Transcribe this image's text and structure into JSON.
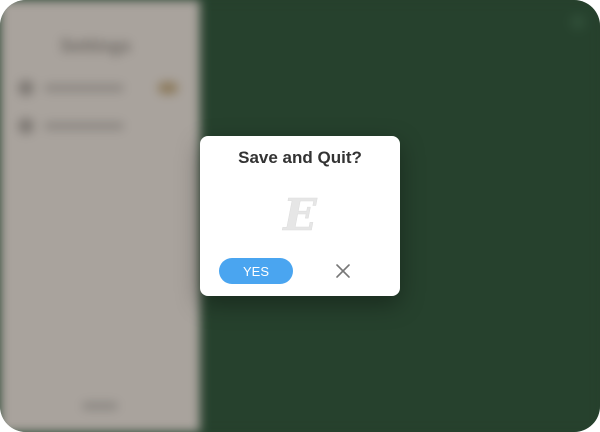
{
  "background_app": {
    "sidebar_title": "Settings",
    "sidebar_items": [
      {
        "label": "Sound"
      },
      {
        "label": "Language"
      }
    ]
  },
  "dialog": {
    "title": "Save and Quit?",
    "logo_letter": "E",
    "yes_label": "YES",
    "close_icon": "close-icon"
  },
  "colors": {
    "accent": "#4aa5f0",
    "background": "#26412d",
    "sidebar": "#a9a39d"
  }
}
